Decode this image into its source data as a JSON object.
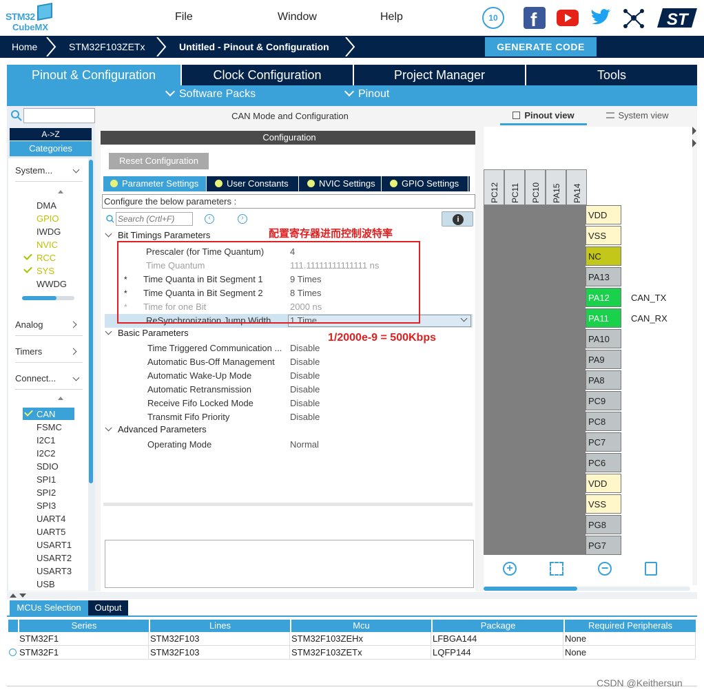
{
  "app": {
    "logo_line1": "STM32",
    "logo_line2": "CubeMX"
  },
  "menu": [
    "File",
    "Window",
    "Help"
  ],
  "badge_text": "10",
  "breadcrumb": [
    "Home",
    "STM32F103ZETx",
    "Untitled - Pinout & Configuration"
  ],
  "generate_label": "GENERATE CODE",
  "main_tabs": [
    "Pinout & Configuration",
    "Clock Configuration",
    "Project Manager",
    "Tools"
  ],
  "sub_tabs": [
    "Software Packs",
    "Pinout"
  ],
  "left": {
    "search_placeholder": "",
    "az": "A->Z",
    "categories": "Categories",
    "system": "System...",
    "system_items": [
      {
        "label": "DMA",
        "color": "#333333",
        "check": false
      },
      {
        "label": "GPIO",
        "color": "#c0c000",
        "check": false
      },
      {
        "label": "IWDG",
        "color": "#333333",
        "check": false
      },
      {
        "label": "NVIC",
        "color": "#c0c000",
        "check": false
      },
      {
        "label": "RCC",
        "color": "#c0c000",
        "check": true
      },
      {
        "label": "SYS",
        "color": "#c0c000",
        "check": true
      },
      {
        "label": "WWDG",
        "color": "#333333",
        "check": false
      }
    ],
    "analog": "Analog",
    "timers": "Timers",
    "connect": "Connect...",
    "connect_items": [
      "CAN",
      "FSMC",
      "I2C1",
      "I2C2",
      "SDIO",
      "SPI1",
      "SPI2",
      "SPI3",
      "UART4",
      "UART5",
      "USART1",
      "USART2",
      "USART3",
      "USB"
    ]
  },
  "mid": {
    "title": "CAN Mode and Configuration",
    "config": "Configuration",
    "reset": "Reset Configuration",
    "tabs": [
      "Parameter Settings",
      "User Constants",
      "NVIC Settings",
      "GPIO Settings"
    ],
    "describe": "Configure the below parameters :",
    "search_placeholder": "Search (Crtl+F)",
    "annotation_top": "配置寄存器进而控制波特率",
    "annotation_mid": "1/2000e-9 = 500Kbps",
    "bit_timings": "Bit Timings Parameters",
    "bit_params": [
      {
        "star": "",
        "name": "Prescaler (for Time Quantum)",
        "value": "4",
        "dim": false
      },
      {
        "star": "",
        "name": "Time Quantum",
        "value": "111.11111111111111 ns",
        "dim": true
      },
      {
        "star": "*",
        "name": "Time Quanta in Bit Segment 1",
        "value": "9 Times",
        "dim": false
      },
      {
        "star": "*",
        "name": "Time Quanta in Bit Segment 2",
        "value": "8 Times",
        "dim": false
      },
      {
        "star": "*",
        "name": "Time for one Bit",
        "value": "2000 ns",
        "dim": true
      },
      {
        "star": "",
        "name": "ReSynchronization Jump Width",
        "value": "1 Time",
        "dim": false
      }
    ],
    "basic": "Basic Parameters",
    "basic_params": [
      {
        "name": "Time Triggered Communication ...",
        "value": "Disable"
      },
      {
        "name": "Automatic Bus-Off Management",
        "value": "Disable"
      },
      {
        "name": "Automatic Wake-Up Mode",
        "value": "Disable"
      },
      {
        "name": "Automatic Retransmission",
        "value": "Disable"
      },
      {
        "name": "Receive Fifo Locked Mode",
        "value": "Disable"
      },
      {
        "name": "Transmit Fifo Priority",
        "value": "Disable"
      }
    ],
    "advanced": "Advanced Parameters",
    "advanced_params": [
      {
        "name": "Operating Mode",
        "value": "Normal"
      }
    ]
  },
  "right": {
    "pinout_view": "Pinout view",
    "system_view": "System view",
    "top_pins": [
      "PC12",
      "PC11",
      "PC10",
      "PA15",
      "PA14"
    ],
    "pins": [
      {
        "name": "VDD",
        "style": "yel",
        "label": ""
      },
      {
        "name": "VSS",
        "style": "yel",
        "label": ""
      },
      {
        "name": "NC",
        "style": "olive",
        "label": ""
      },
      {
        "name": "PA13",
        "style": "",
        "label": ""
      },
      {
        "name": "PA12",
        "style": "green",
        "label": "CAN_TX"
      },
      {
        "name": "PA11",
        "style": "green",
        "label": "CAN_RX"
      },
      {
        "name": "PA10",
        "style": "",
        "label": ""
      },
      {
        "name": "PA9",
        "style": "",
        "label": ""
      },
      {
        "name": "PA8",
        "style": "",
        "label": ""
      },
      {
        "name": "PC9",
        "style": "",
        "label": ""
      },
      {
        "name": "PC8",
        "style": "",
        "label": ""
      },
      {
        "name": "PC7",
        "style": "",
        "label": ""
      },
      {
        "name": "PC6",
        "style": "",
        "label": ""
      },
      {
        "name": "VDD",
        "style": "yel",
        "label": ""
      },
      {
        "name": "VSS",
        "style": "yel",
        "label": ""
      },
      {
        "name": "PG8",
        "style": "",
        "label": ""
      },
      {
        "name": "PG7",
        "style": "",
        "label": ""
      }
    ]
  },
  "bottom": {
    "tabs": [
      "MCUs Selection",
      "Output"
    ],
    "headers": [
      "Series",
      "Lines",
      "Mcu",
      "Package",
      "Required Peripherals"
    ],
    "rows": [
      [
        "STM32F1",
        "STM32F103",
        "STM32F103ZEHx",
        "LFBGA144",
        "None"
      ],
      [
        "STM32F1",
        "STM32F103",
        "STM32F103ZETx",
        "LQFP144",
        "None"
      ]
    ]
  },
  "watermark": "CSDN @Keithersun"
}
